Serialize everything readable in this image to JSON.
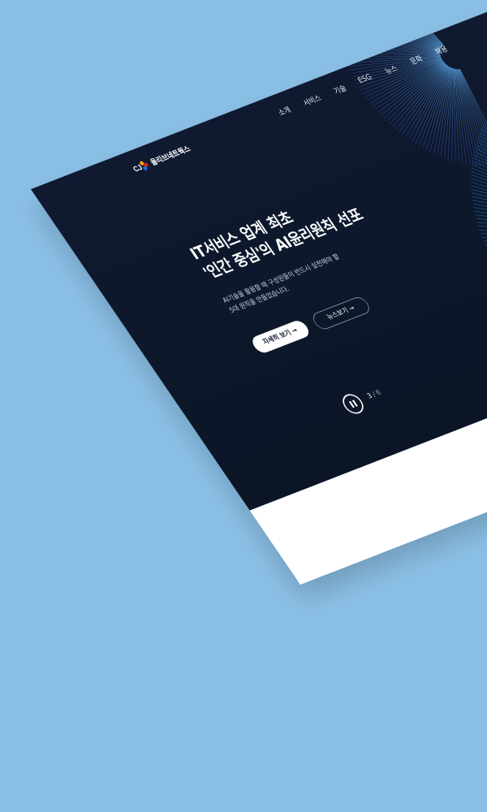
{
  "header": {
    "logo_text": "올리브네트웍스",
    "nav": [
      "소개",
      "서비스",
      "기술",
      "ESG",
      "뉴스",
      "문화",
      "채용"
    ]
  },
  "hero": {
    "headline_line1": "IT서비스 업계 최초",
    "headline_line2": "'인간 중심'의 AI윤리원칙 선포",
    "subtext_line1": "AI기술을 활용할 때 구성원들이 반드시 실천해야 할",
    "subtext_line2": "5대 원칙을 만들었습니다.",
    "primary_button": "자세히 보기 →",
    "secondary_button": "뉴스보기 →"
  },
  "slider": {
    "current": "3",
    "total": "/ 6"
  },
  "colors": {
    "background": "#8bc0e6",
    "hero": "#0f1a30",
    "accent_teal": "#2fb7a6",
    "accent_blue": "#3a6fd8"
  },
  "icons": {
    "logo": "cj-logo-icon",
    "pause": "pause-icon"
  }
}
